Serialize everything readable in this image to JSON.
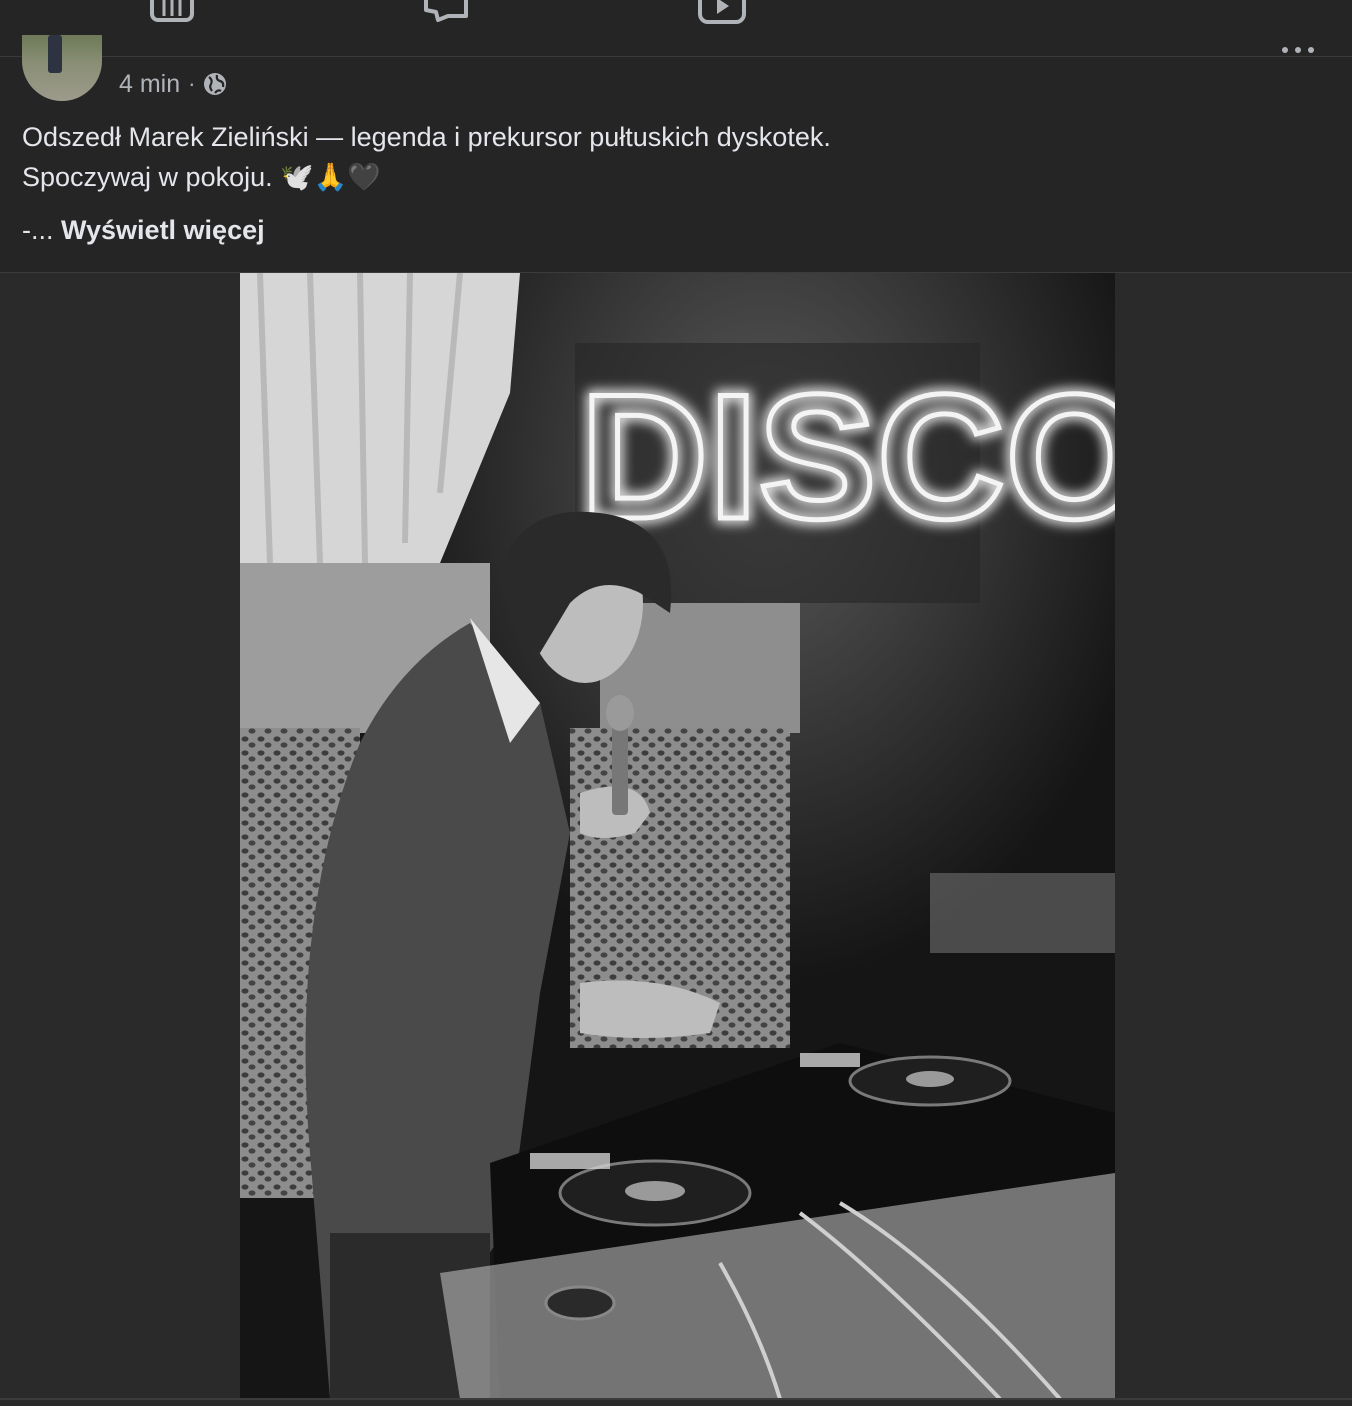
{
  "nav": {
    "icons": [
      "marketplace-icon",
      "groups-megaphone-icon",
      "watch-video-icon"
    ]
  },
  "post": {
    "time": "4 min",
    "separator": "·",
    "privacy_icon": "globe-icon",
    "text_line1": "Odszedł Marek Zieliński — legenda i prekursor pułtuskich dyskotek.",
    "text_line2": "Spoczywaj w pokoju. 🕊️🙏🖤",
    "ellipsis": "-...",
    "see_more": "Wyświetl więcej"
  },
  "photo": {
    "neon_sign": "DISCO"
  },
  "colors": {
    "background": "#252526",
    "text": "#e4e6eb",
    "secondary_text": "#b0b3b8"
  }
}
